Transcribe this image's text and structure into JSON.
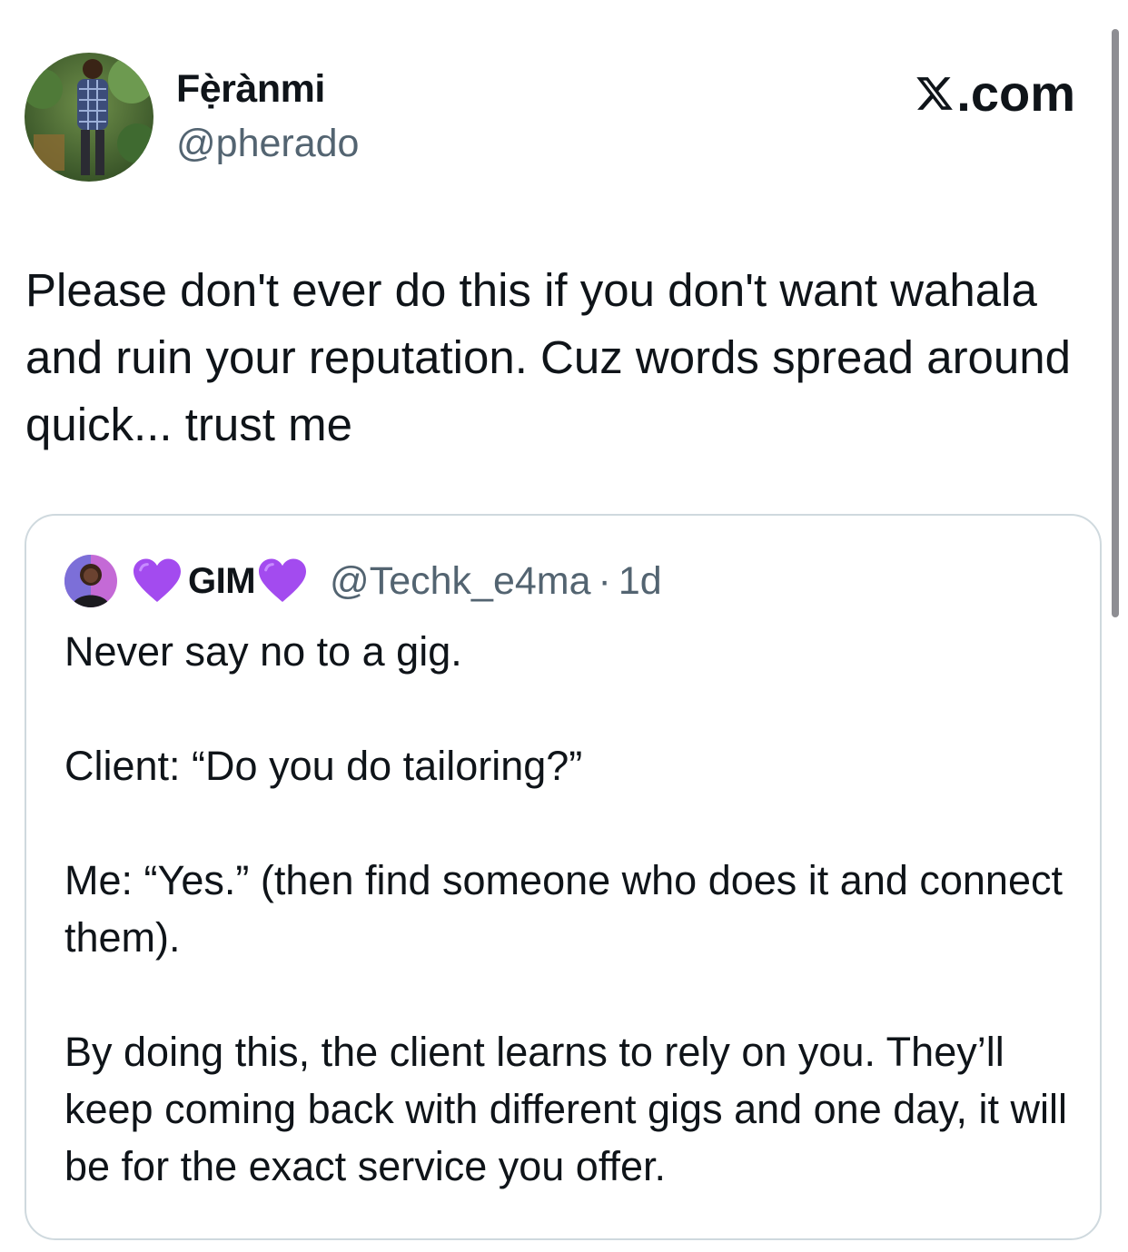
{
  "tweet": {
    "author": {
      "display_name": "Fẹ̀rànmi",
      "handle": "@pherado",
      "avatar_icon": "profile-photo-icon"
    },
    "brand": {
      "label": ".com",
      "logo_icon": "x-logo-icon"
    },
    "text_lines": [
      "Please don't ever do this if you don't want wahala and ruin your reputation. Cuz words spread around quick... trust me"
    ],
    "quoted": {
      "avatar_icon": "profile-photo-icon",
      "name_prefix_icon": "purple-heart-icon",
      "name": "GIM",
      "name_suffix_icon": "purple-heart-icon",
      "handle": "@Techk_e4ma",
      "separator": "·",
      "time": "1d",
      "paragraphs": [
        "Never say no to a gig.",
        "Client: “Do you do tailoring?”",
        "Me: “Yes.” (then find someone who does it and connect them).",
        "By doing this, the client learns to rely on you. They’ll keep coming back with different gigs and one day, it will be for the exact service you offer."
      ]
    }
  },
  "colors": {
    "text_primary": "#0f1419",
    "text_secondary": "#536471",
    "border": "#cfd9de",
    "heart": "#a34bef"
  }
}
